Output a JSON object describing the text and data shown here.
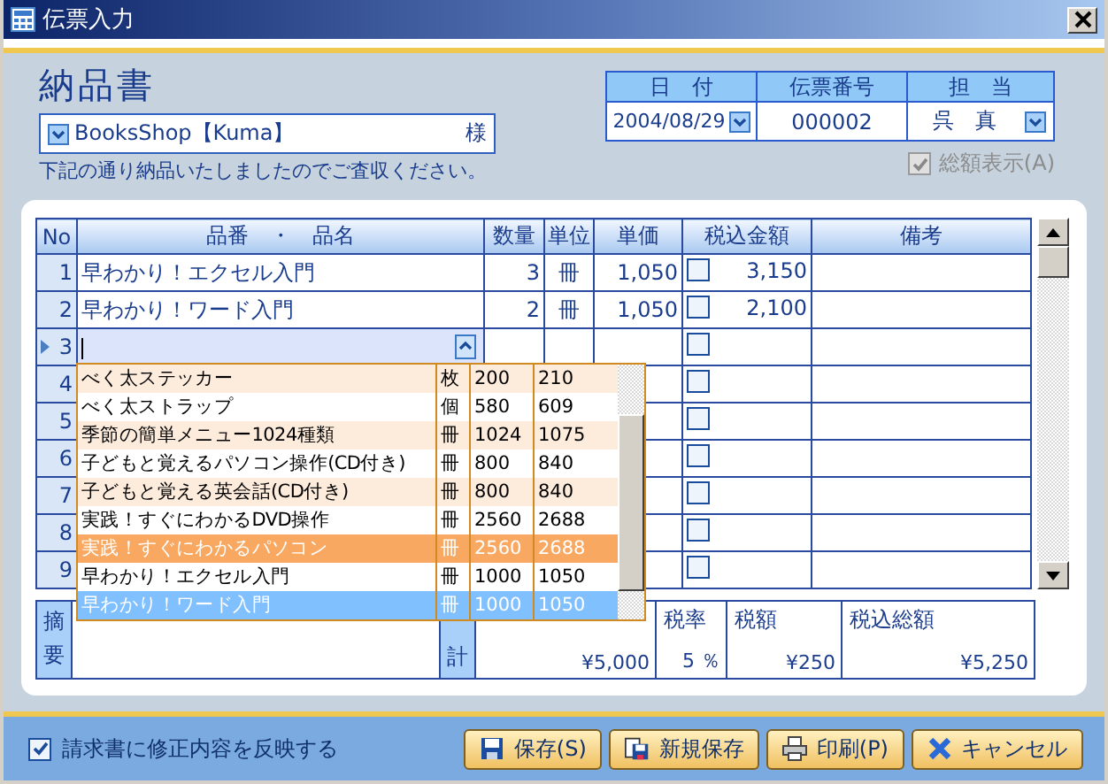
{
  "window": {
    "title": "伝票入力"
  },
  "document": {
    "title": "納品書",
    "customer": {
      "value": "BooksShop【Kuma】",
      "suffix": "様"
    },
    "note": "下記の通り納品いたしましたのでご査収ください。"
  },
  "info_table": {
    "columns": [
      "日　付",
      "伝票番号",
      "担　当"
    ],
    "date": "2004/08/29",
    "slip_number": "000002",
    "staff": "呉　真"
  },
  "total_display": {
    "label": "総額表示(A)",
    "checked": true,
    "disabled": true
  },
  "grid": {
    "columns": [
      "No",
      "品番　・　品名",
      "数量",
      "単位",
      "単価",
      "税込金額",
      "備考"
    ],
    "rows": [
      {
        "no": "1",
        "name": "早わかり！エクセル入門",
        "qty": "3",
        "unit": "冊",
        "price": "1,050",
        "checked": false,
        "amount": "3,150",
        "current": false
      },
      {
        "no": "2",
        "name": "早わかり！ワード入門",
        "qty": "2",
        "unit": "冊",
        "price": "1,050",
        "checked": false,
        "amount": "2,100",
        "current": false
      },
      {
        "no": "3",
        "name": "",
        "qty": "",
        "unit": "",
        "price": "",
        "checked": false,
        "amount": "",
        "current": true
      },
      {
        "no": "4",
        "name": "",
        "qty": "",
        "unit": "",
        "price": "",
        "checked": false,
        "amount": "",
        "current": false
      },
      {
        "no": "5",
        "name": "",
        "qty": "",
        "unit": "",
        "price": "",
        "checked": false,
        "amount": "",
        "current": false
      },
      {
        "no": "6",
        "name": "",
        "qty": "",
        "unit": "",
        "price": "",
        "checked": false,
        "amount": "",
        "current": false
      },
      {
        "no": "7",
        "name": "",
        "qty": "",
        "unit": "",
        "price": "",
        "checked": false,
        "amount": "",
        "current": false
      },
      {
        "no": "8",
        "name": "",
        "qty": "",
        "unit": "",
        "price": "",
        "checked": false,
        "amount": "",
        "current": false
      },
      {
        "no": "9",
        "name": "",
        "qty": "",
        "unit": "",
        "price": "",
        "checked": false,
        "amount": "",
        "current": false
      }
    ]
  },
  "dropdown": {
    "items": [
      {
        "name": "べく太ステッカー",
        "unit": "枚",
        "price": "200",
        "tax_price": "210",
        "striped": true,
        "hovered": false,
        "selected": false
      },
      {
        "name": "べく太ストラップ",
        "unit": "個",
        "price": "580",
        "tax_price": "609",
        "striped": false,
        "hovered": false,
        "selected": false
      },
      {
        "name": "季節の簡単メニュー1024種類",
        "unit": "冊",
        "price": "1024",
        "tax_price": "1075",
        "striped": true,
        "hovered": false,
        "selected": false
      },
      {
        "name": "子どもと覚えるパソコン操作(CD付き)",
        "unit": "冊",
        "price": "800",
        "tax_price": "840",
        "striped": false,
        "hovered": false,
        "selected": false
      },
      {
        "name": "子どもと覚える英会話(CD付き)",
        "unit": "冊",
        "price": "800",
        "tax_price": "840",
        "striped": true,
        "hovered": false,
        "selected": false
      },
      {
        "name": "実践！すぐにわかるDVD操作",
        "unit": "冊",
        "price": "2560",
        "tax_price": "2688",
        "striped": false,
        "hovered": false,
        "selected": false
      },
      {
        "name": "実践！すぐにわかるパソコン",
        "unit": "冊",
        "price": "2560",
        "tax_price": "2688",
        "striped": false,
        "hovered": true,
        "selected": false
      },
      {
        "name": "早わかり！エクセル入門",
        "unit": "冊",
        "price": "1000",
        "tax_price": "1050",
        "striped": false,
        "hovered": false,
        "selected": false
      },
      {
        "name": "早わかり！ワード入門",
        "unit": "冊",
        "price": "1000",
        "tax_price": "1050",
        "striped": false,
        "hovered": false,
        "selected": true
      }
    ]
  },
  "summary": {
    "memo_label": "摘要",
    "total_label": "計",
    "subtotal": "¥5,000",
    "tax_rate_label": "税率",
    "tax_rate": "5 ％",
    "tax_label": "税額",
    "tax": "¥250",
    "grand_total_label": "税込総額",
    "grand_total": "¥5,250"
  },
  "footer": {
    "reflect": {
      "label": "請求書に修正内容を反映する",
      "checked": true
    },
    "buttons": [
      {
        "label": "保存(S)",
        "kind": "save"
      },
      {
        "label": "新規保存",
        "kind": "save_new"
      },
      {
        "label": "印刷(P)",
        "kind": "print"
      },
      {
        "label": "キャンセル",
        "kind": "cancel"
      }
    ]
  }
}
